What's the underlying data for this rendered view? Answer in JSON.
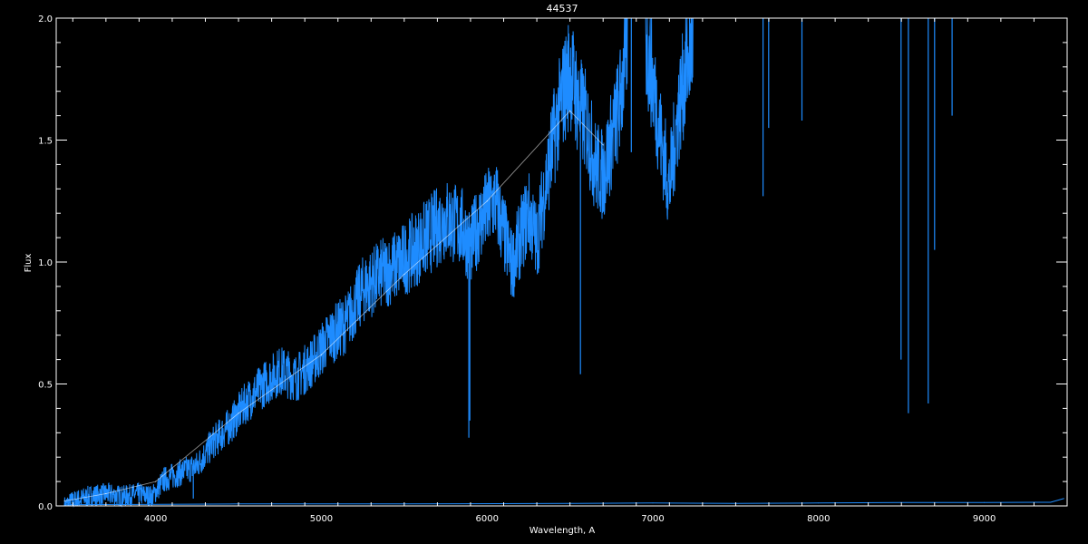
{
  "chart_data": {
    "type": "line",
    "title": "44537",
    "xlabel": "Wavelength, A",
    "ylabel": "Flux",
    "xlim": [
      3400,
      9500
    ],
    "ylim": [
      0.0,
      2.0
    ],
    "x_ticks": [
      4000,
      5000,
      6000,
      7000,
      8000,
      9000
    ],
    "x_tick_labels": [
      "4000",
      "5000",
      "6000",
      "7000",
      "8000",
      "9000"
    ],
    "y_ticks": [
      0.0,
      0.5,
      1.0,
      1.5,
      2.0
    ],
    "y_tick_labels": [
      "0.0",
      "0.5",
      "1.0",
      "1.5",
      "2.0"
    ],
    "grid": false,
    "colors": {
      "background": "#000000",
      "frame": "#ffffff",
      "spectrum": "#1e8cff",
      "continuum": "#ffffff"
    },
    "series": [
      {
        "role": "spectrum",
        "x": [
          3450,
          3500,
          3600,
          3700,
          3800,
          3900,
          3980,
          4050,
          4150,
          4250,
          4350,
          4450,
          4550,
          4650,
          4750,
          4850,
          4950,
          5050,
          5150,
          5250,
          5350,
          5450,
          5550,
          5650,
          5750,
          5850,
          5900,
          5950,
          6050,
          6150,
          6250,
          6300,
          6350,
          6400,
          6450,
          6500,
          6550,
          6600,
          6650,
          6700,
          6750,
          6800,
          6850,
          6900,
          6950,
          7000,
          7050,
          7100,
          7150,
          7200,
          7250,
          7300,
          7350,
          7400,
          7600,
          7800,
          8000,
          8200,
          8400,
          8600,
          8800,
          9000,
          9200,
          9300,
          9400,
          9480
        ],
        "y": [
          0.01,
          0.03,
          0.05,
          0.06,
          0.05,
          0.06,
          0.05,
          0.12,
          0.15,
          0.18,
          0.28,
          0.35,
          0.45,
          0.52,
          0.58,
          0.55,
          0.62,
          0.72,
          0.78,
          0.92,
          0.98,
          1.02,
          1.08,
          1.15,
          1.22,
          1.18,
          1.1,
          1.2,
          1.3,
          1.02,
          1.25,
          1.12,
          1.35,
          1.55,
          1.72,
          1.85,
          1.7,
          1.62,
          1.45,
          1.4,
          1.55,
          1.7,
          2.0,
          2.0,
          2.0,
          1.8,
          1.55,
          1.35,
          1.65,
          1.85,
          2.0,
          2.0,
          2.0,
          2.0,
          2.0,
          2.0,
          2.0,
          2.0,
          2.0,
          2.0,
          2.0,
          2.0,
          2.0,
          2.0,
          2.0,
          2.0
        ]
      },
      {
        "role": "continuum",
        "x": [
          3450,
          3700,
          4000,
          4500,
          5000,
          5500,
          6000,
          6500,
          6700
        ],
        "y": [
          0.02,
          0.05,
          0.1,
          0.38,
          0.62,
          0.95,
          1.25,
          1.62,
          1.48
        ]
      },
      {
        "role": "error",
        "x": [
          3450,
          4500,
          5500,
          6500,
          7000,
          7500,
          8000,
          8500,
          9000,
          9400,
          9480
        ],
        "y": [
          0.005,
          0.008,
          0.008,
          0.01,
          0.012,
          0.01,
          0.012,
          0.014,
          0.014,
          0.015,
          0.03
        ]
      }
    ],
    "absorption_lines": [
      {
        "x": 3934,
        "y": 0.02
      },
      {
        "x": 3968,
        "y": 0.02
      },
      {
        "x": 4227,
        "y": 0.03
      },
      {
        "x": 5890,
        "y": 0.28
      },
      {
        "x": 5896,
        "y": 0.35
      },
      {
        "x": 6563,
        "y": 0.54
      },
      {
        "x": 6870,
        "y": 1.45
      },
      {
        "x": 7665,
        "y": 1.27
      },
      {
        "x": 7699,
        "y": 1.55
      },
      {
        "x": 7900,
        "y": 1.58
      },
      {
        "x": 8498,
        "y": 0.6
      },
      {
        "x": 8542,
        "y": 0.38
      },
      {
        "x": 8662,
        "y": 0.42
      },
      {
        "x": 8700,
        "y": 1.05
      },
      {
        "x": 8806,
        "y": 1.6
      }
    ]
  }
}
